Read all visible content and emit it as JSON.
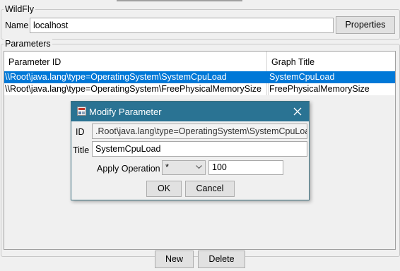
{
  "wildfly": {
    "legend": "WildFly",
    "name_label": "Name",
    "name_value": "localhost",
    "properties_button": "Properties"
  },
  "parameters": {
    "legend": "Parameters",
    "columns": [
      "Parameter ID",
      "Graph Title"
    ],
    "rows": [
      {
        "id": "\\\\Root\\java.lang\\type=OperatingSystem\\SystemCpuLoad",
        "title": "SystemCpuLoad",
        "selected": true
      },
      {
        "id": "\\\\Root\\java.lang\\type=OperatingSystem\\FreePhysicalMemorySize",
        "title": "FreePhysicalMemorySize",
        "selected": false
      }
    ],
    "new_button": "New",
    "delete_button": "Delete"
  },
  "dialog": {
    "title": "Modify Parameter",
    "id_label": "ID",
    "id_value": ".Root\\java.lang\\type=OperatingSystem\\SystemCpuLoad",
    "title_label": "Title",
    "title_value": "SystemCpuLoad",
    "apply_label": "Apply Operation",
    "operation_value": "*",
    "operand_value": "100",
    "ok_button": "OK",
    "cancel_button": "Cancel"
  },
  "colors": {
    "selection": "#0078d7",
    "titlebar": "#2a7393"
  },
  "icons": {
    "dialog_icon": "app-window-icon",
    "close": "close-icon",
    "combo_arrow": "chevron-down-icon"
  }
}
